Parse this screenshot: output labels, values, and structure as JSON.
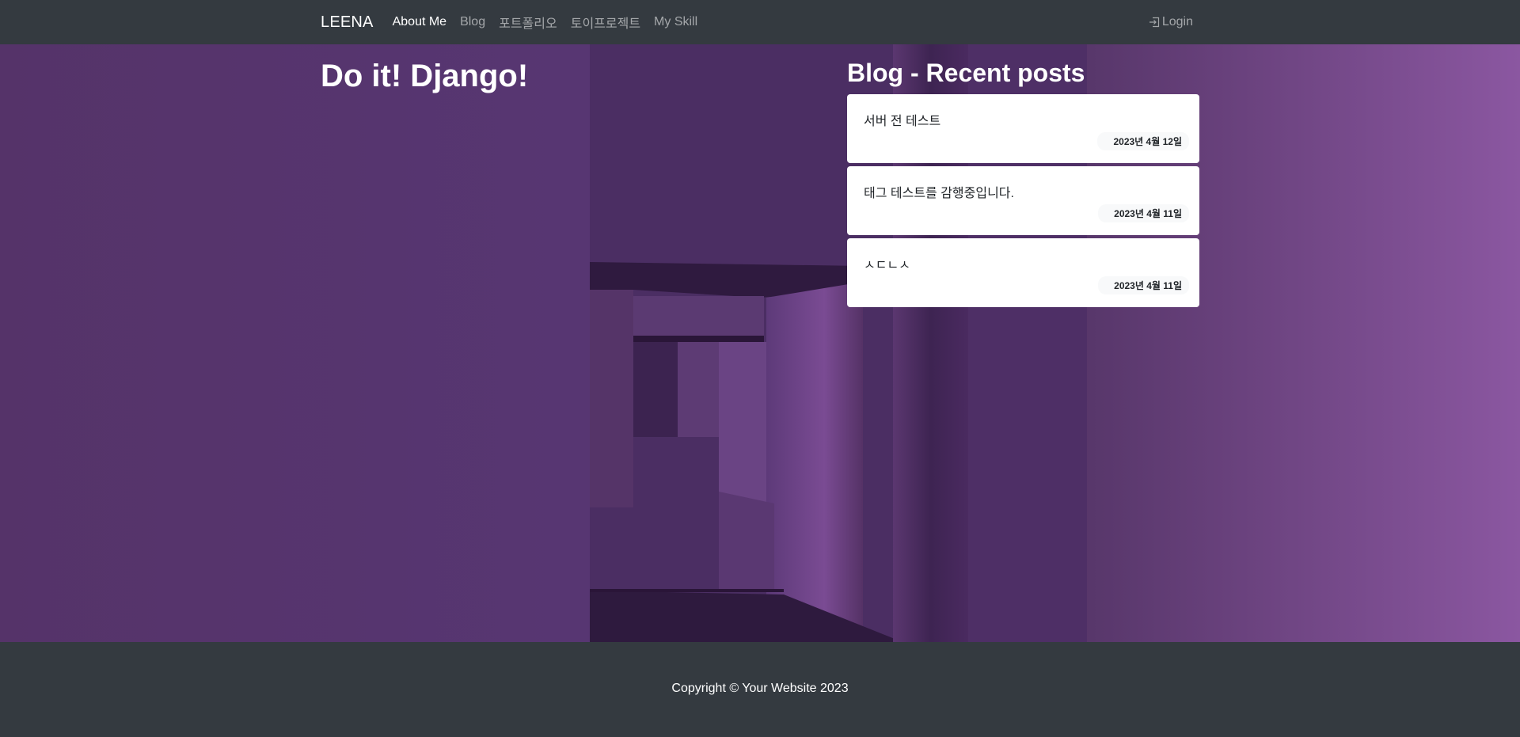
{
  "navbar": {
    "brand": "LEENA",
    "links": [
      {
        "label": "About Me",
        "active": true
      },
      {
        "label": "Blog",
        "active": false
      },
      {
        "label": "포트폴리오",
        "active": false
      },
      {
        "label": "토이프로젝트",
        "active": false
      },
      {
        "label": "My Skill",
        "active": false
      }
    ],
    "login": {
      "icon": "login-icon",
      "label": "Login"
    }
  },
  "hero": {
    "title": "Do it! Django!",
    "recent_title": "Blog - Recent posts",
    "posts": [
      {
        "title": "서버 전 테스트",
        "date": "2023년 4월 12일"
      },
      {
        "title": "태그 테스트를 감행중입니다.",
        "date": "2023년 4월 11일"
      },
      {
        "title": "ㅅㄷㄴㅅ",
        "date": "2023년 4월 11일"
      }
    ]
  },
  "footer": {
    "copyright": "Copyright © Your Website 2023"
  },
  "colors": {
    "navbar_bg": "#343a40",
    "hero_purple": "#5a3876",
    "card_bg": "#ffffff"
  }
}
